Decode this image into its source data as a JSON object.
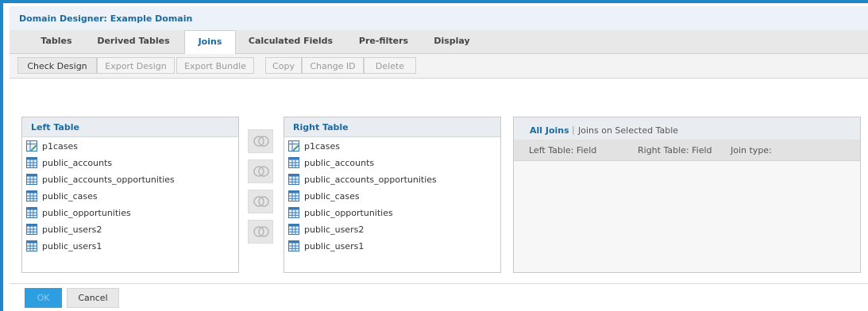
{
  "window": {
    "title": "Domain Designer: Example Domain"
  },
  "tabs": [
    {
      "label": "Tables"
    },
    {
      "label": "Derived Tables"
    },
    {
      "label": "Joins"
    },
    {
      "label": "Calculated Fields"
    },
    {
      "label": "Pre-filters"
    },
    {
      "label": "Display"
    }
  ],
  "active_tab": "Joins",
  "toolbar": {
    "check_design": "Check Design",
    "export_design": "Export Design",
    "export_bundle": "Export Bundle",
    "copy": "Copy",
    "change_id": "Change ID",
    "delete": "Delete"
  },
  "left_table": {
    "title": "Left Table",
    "items": [
      {
        "label": "p1cases",
        "icon": "derived-table-icon"
      },
      {
        "label": "public_accounts",
        "icon": "table-icon"
      },
      {
        "label": "public_accounts_opportunities",
        "icon": "table-icon"
      },
      {
        "label": "public_cases",
        "icon": "table-icon"
      },
      {
        "label": "public_opportunities",
        "icon": "table-icon"
      },
      {
        "label": "public_users2",
        "icon": "table-icon"
      },
      {
        "label": "public_users1",
        "icon": "table-icon"
      }
    ]
  },
  "right_table": {
    "title": "Right Table",
    "items": [
      {
        "label": "p1cases",
        "icon": "derived-table-icon"
      },
      {
        "label": "public_accounts",
        "icon": "table-icon"
      },
      {
        "label": "public_accounts_opportunities",
        "icon": "table-icon"
      },
      {
        "label": "public_cases",
        "icon": "table-icon"
      },
      {
        "label": "public_opportunities",
        "icon": "table-icon"
      },
      {
        "label": "public_users2",
        "icon": "table-icon"
      },
      {
        "label": "public_users1",
        "icon": "table-icon"
      }
    ]
  },
  "join_buttons": [
    "inner-join-icon",
    "left-outer-join-icon",
    "right-outer-join-icon",
    "full-outer-join-icon"
  ],
  "joins": {
    "all_joins": "All Joins",
    "separator": "|",
    "selected_table": "Joins on Selected Table",
    "col_left": "Left Table: Field",
    "col_right": "Right Table: Field",
    "col_type": "Join type:"
  },
  "footer": {
    "ok": "OK",
    "cancel": "Cancel"
  },
  "colors": {
    "accent": "#1e88c8",
    "title_text": "#1c6aa0",
    "ok_button": "#2d9ee0"
  }
}
